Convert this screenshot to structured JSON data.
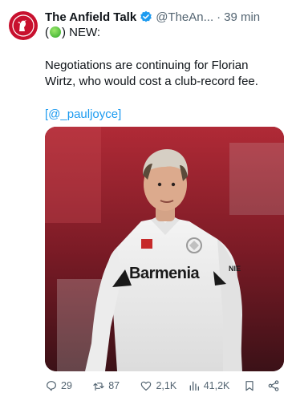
{
  "author": {
    "name": "The Anfield Talk",
    "handle": "@TheAn...",
    "separator": "·",
    "time": "39 min"
  },
  "tweet": {
    "line1_open": "(",
    "line1_close": ") NEW:",
    "paragraph1": "Negotiations are continuing for Florian",
    "paragraph2": "Wirtz, who would cost a club-record fee.",
    "mention_open": "[",
    "mention": "@_pauljoyce",
    "mention_close": "]"
  },
  "media": {
    "shirt_sponsor": "Barmenia",
    "sleeve_text": "NIE"
  },
  "actions": {
    "replies": "29",
    "reposts": "87",
    "likes": "2,1K",
    "views": "41,2K"
  },
  "colors": {
    "link": "#1d9bf0",
    "verified": "#1d9bf0",
    "secondary_text": "#536471",
    "avatar_red": "#c8102e"
  }
}
